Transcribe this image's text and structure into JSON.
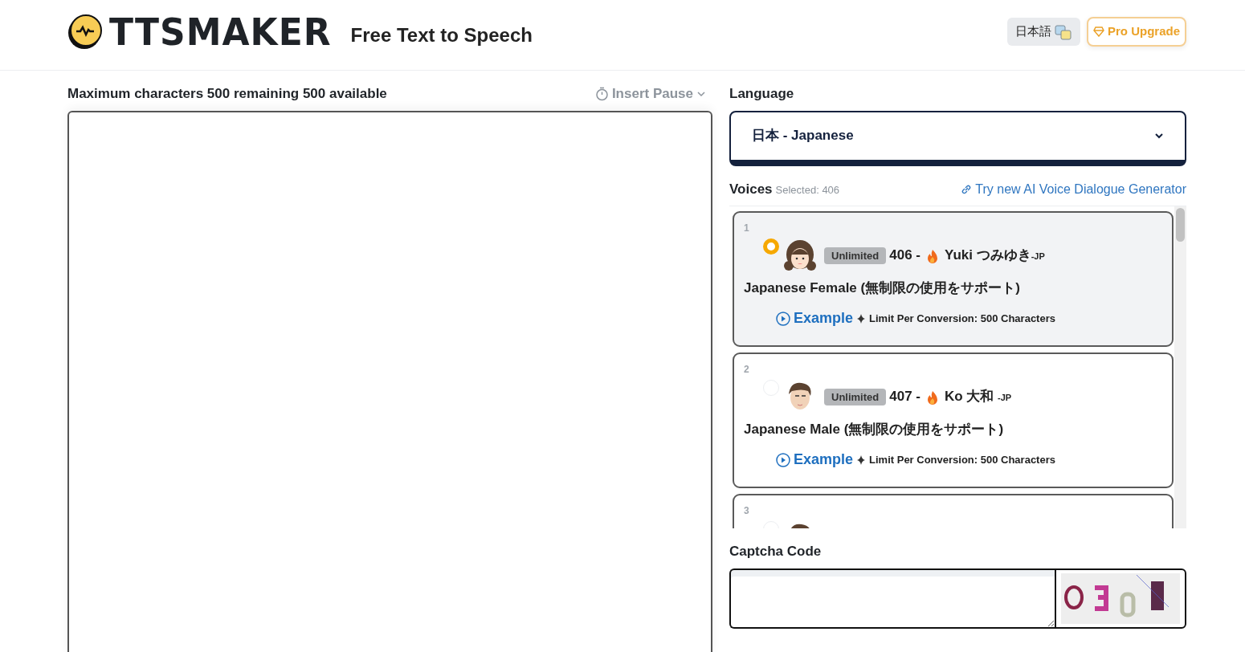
{
  "header": {
    "logo_text": "TTSMAKER",
    "tagline": "Free Text to Speech",
    "language_button": "日本語",
    "upgrade_button": "Pro Upgrade"
  },
  "editor": {
    "char_info": "Maximum characters 500 remaining 500 available",
    "insert_pause": "Insert Pause"
  },
  "language": {
    "label": "Language",
    "value": "日本 - Japanese"
  },
  "voices": {
    "label": "Voices",
    "selected_info": "Selected: 406",
    "dialogue_link": "Try new AI Voice Dialogue Generator",
    "items": [
      {
        "number": "1",
        "selected": true,
        "kind": "woman",
        "badge": "Unlimited",
        "id": "406 -",
        "name": "Yuki つみゆき",
        "region": "-JP",
        "description": "Japanese Female (無制限の使用をサポート)",
        "example": "Example",
        "limit": "Limit Per Conversion: 500 Characters"
      },
      {
        "number": "2",
        "selected": false,
        "kind": "man",
        "badge": "Unlimited",
        "id": "407 -",
        "name": "Ko 大和 ",
        "region": "-JP",
        "description": "Japanese Male (無制限の使用をサポート)",
        "example": "Example",
        "limit": "Limit Per Conversion: 500 Characters"
      },
      {
        "number": "3",
        "selected": false,
        "kind": "man"
      }
    ]
  },
  "captcha": {
    "label": "Captcha Code"
  }
}
